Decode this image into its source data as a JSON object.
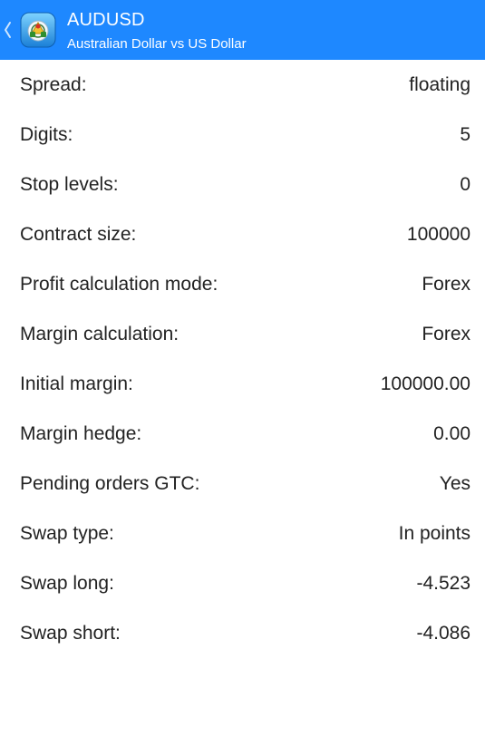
{
  "colors": {
    "header_background": "#1e88ff",
    "header_text": "#ffffff",
    "body_text": "#222222",
    "page_background": "#ffffff"
  },
  "header": {
    "back_icon": "chevron-left-icon",
    "app_icon": "metatrader-app-icon",
    "symbol": "AUDUSD",
    "description": "Australian Dollar vs US Dollar"
  },
  "properties": [
    {
      "label": "Spread:",
      "value": "floating"
    },
    {
      "label": "Digits:",
      "value": "5"
    },
    {
      "label": "Stop levels:",
      "value": "0"
    },
    {
      "label": "Contract size:",
      "value": "100000"
    },
    {
      "label": "Profit calculation mode:",
      "value": "Forex"
    },
    {
      "label": "Margin calculation:",
      "value": "Forex"
    },
    {
      "label": "Initial margin:",
      "value": "100000.00"
    },
    {
      "label": "Margin hedge:",
      "value": "0.00"
    },
    {
      "label": "Pending orders GTC:",
      "value": "Yes"
    },
    {
      "label": "Swap type:",
      "value": "In points"
    },
    {
      "label": "Swap long:",
      "value": "-4.523"
    },
    {
      "label": "Swap short:",
      "value": "-4.086"
    }
  ]
}
